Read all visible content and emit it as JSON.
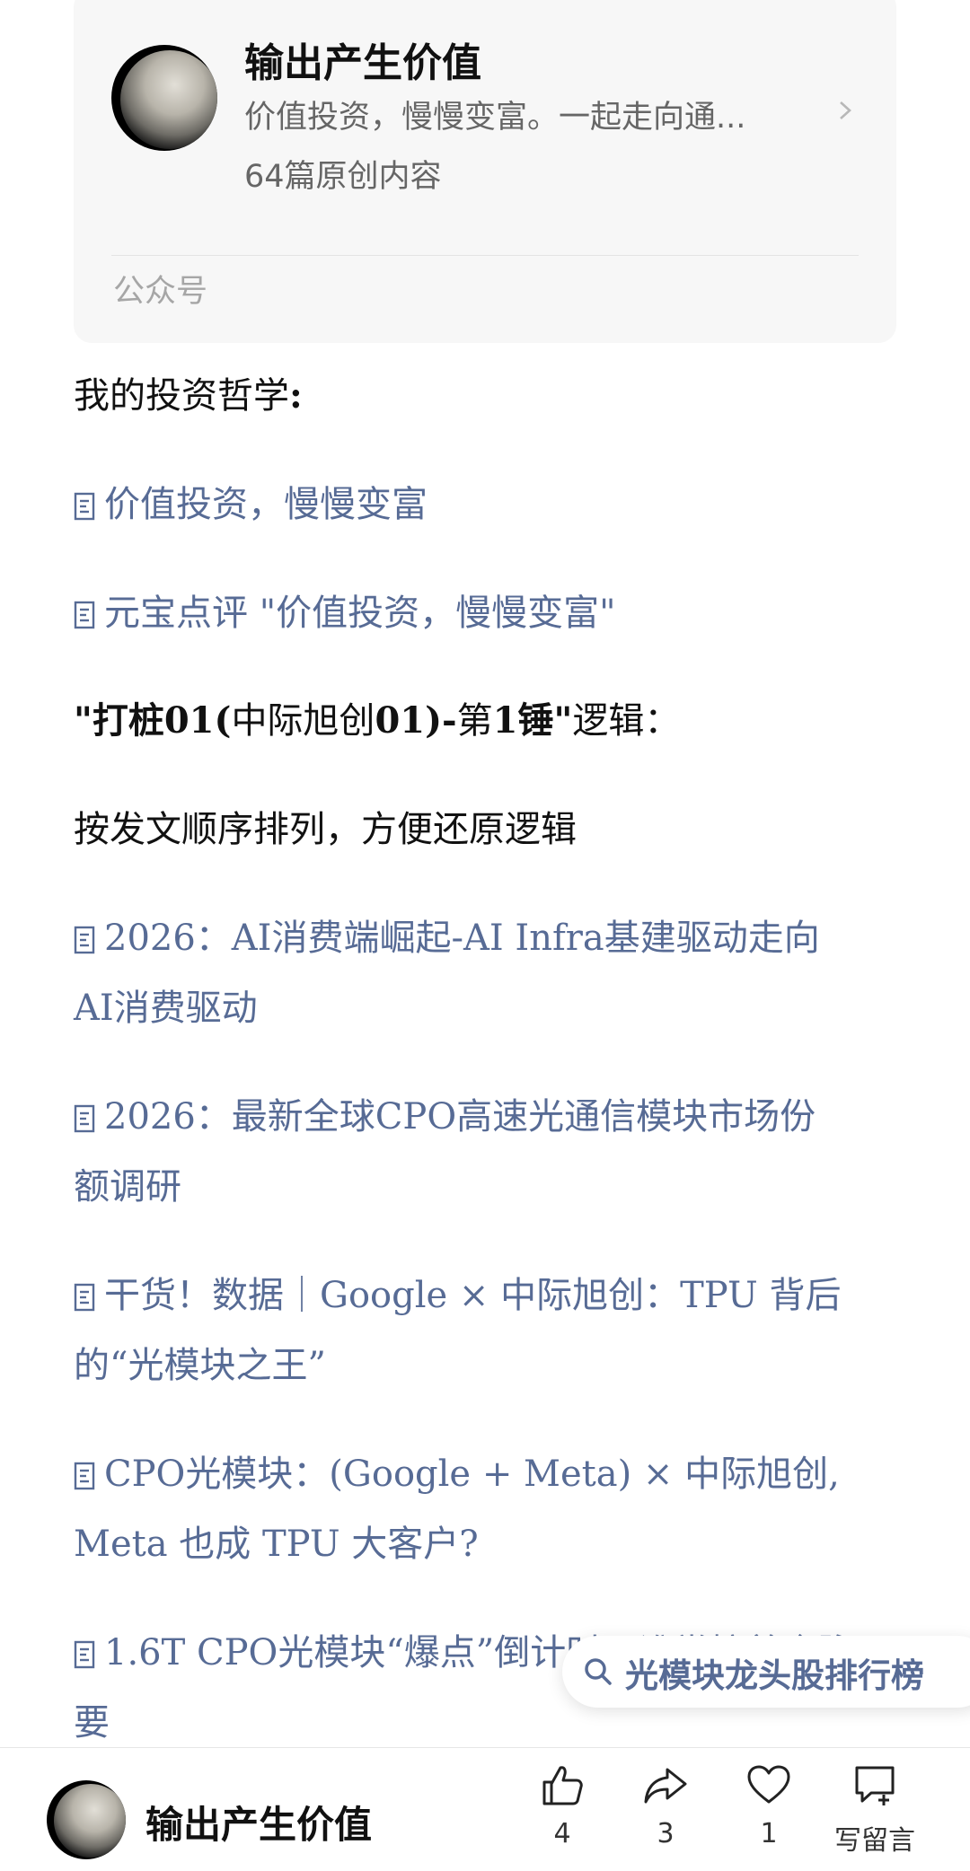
{
  "account_card": {
    "name": "输出产生价值",
    "description": "价值投资，慢慢变富。一起走向通...",
    "count": "64篇原创内容",
    "type": "公众号"
  },
  "article": {
    "heading1_a": "我的投资哲学",
    "heading1_b": ":",
    "links1": [
      "价值投资，慢慢变富",
      "元宝点评 \"价值投资，慢慢变富\""
    ],
    "heading2_a": "\"打桩",
    "heading2_b": "01(",
    "heading2_c": "中际旭创",
    "heading2_d": "01)-",
    "heading2_e": "第",
    "heading2_f": "1",
    "heading2_g": "锤\"",
    "heading2_h": "逻辑：",
    "subtitle": "按发文顺序排列，方便还原逻辑",
    "links2": [
      {
        "line1": "2026：AI消费端崛起-AI Infra基建驱动走向",
        "line2": "AI消费驱动"
      },
      {
        "line1": "2026：最新全球CPO高速光通信模块市场份",
        "line2": "额调研"
      },
      {
        "line1": "干货！数据｜Google × 中际旭创：TPU 背后",
        "line2": "的“光模块之王”"
      },
      {
        "line1": "CPO光模块：(Google + Meta) × 中际旭创,",
        "line2": "Meta 也成 TPU 大客户?"
      },
      {
        "line1": "1.6T CPO光模块“爆点”倒计时：谁掌控着命脉",
        "line2": "要"
      }
    ]
  },
  "floating_search": {
    "label": "光模块龙头股排行榜",
    "icon": "search-icon"
  },
  "bottom_bar": {
    "name": "输出产生价值",
    "like_count": "4",
    "share_count": "3",
    "favorite_count": "1",
    "comment_label": "写留言"
  },
  "colors": {
    "link": "#576b95",
    "text": "#111111",
    "card_bg": "#f7f7f7"
  }
}
